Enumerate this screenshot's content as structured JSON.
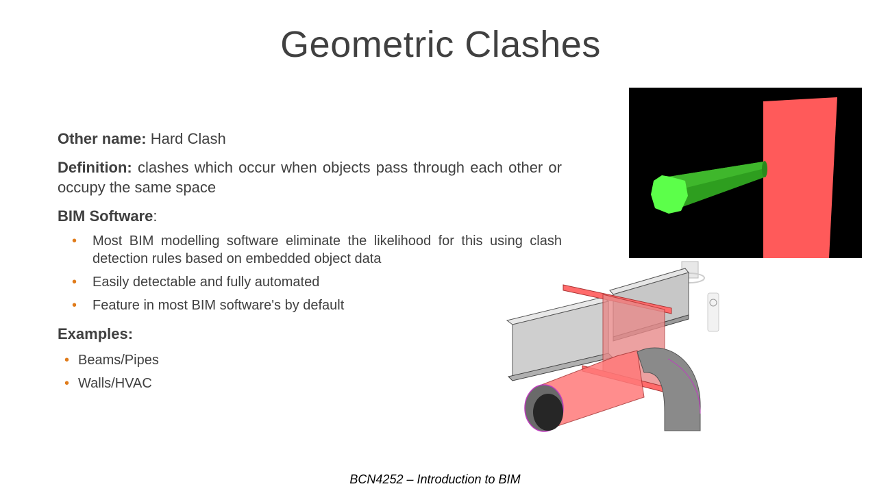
{
  "slide": {
    "title": "Geometric Clashes",
    "footer": "BCN4252 – Introduction to BIM"
  },
  "content": {
    "other_name_label": "Other name:",
    "other_name_value": " Hard Clash",
    "definition_label": "Definition:",
    "definition_value": " clashes which occur when objects pass through each other or occupy the same space",
    "bim_software_label": "BIM Software",
    "bim_software_colon": ":",
    "bim_points": [
      "Most BIM modelling software eliminate the likelihood for this using clash detection rules based on embedded object data",
      "Easily detectable and fully automated",
      "Feature in most BIM software's by default"
    ],
    "examples_label": "Examples:",
    "examples": [
      "Beams/Pipes",
      "Walls/HVAC"
    ]
  },
  "colors": {
    "bullet": "#e07b1a",
    "clash_wall": "#ff5a5a",
    "pipe_green": "#2e9e1f"
  }
}
